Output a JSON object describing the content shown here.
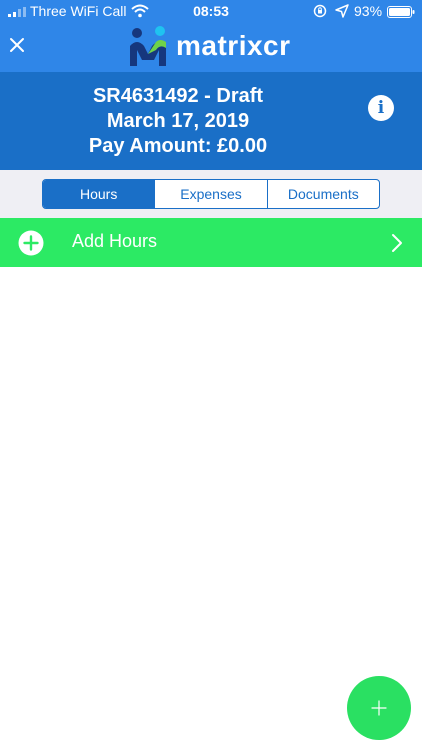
{
  "status_bar": {
    "carrier": "Three WiFi Call",
    "time": "08:53",
    "battery": "93%",
    "icons": [
      "signal-icon",
      "wifi-icon",
      "orientation-lock-icon",
      "location-icon",
      "battery-icon"
    ]
  },
  "nav": {
    "logo_text": "matrixcr",
    "close_icon": "close-icon"
  },
  "header": {
    "reference": "SR4631492 - Draft",
    "date": "March 17, 2019",
    "pay_amount": "Pay Amount: £0.00",
    "info_label": "i"
  },
  "tabs": [
    {
      "label": "Hours",
      "active": true
    },
    {
      "label": "Expenses",
      "active": false
    },
    {
      "label": "Documents",
      "active": false
    }
  ],
  "add_row": {
    "label": "Add Hours"
  },
  "colors": {
    "nav_bg": "#2f86e8",
    "header_bg": "#1a6fc7",
    "accent_green": "#2cea64",
    "segment_bg": "#efeff4"
  }
}
